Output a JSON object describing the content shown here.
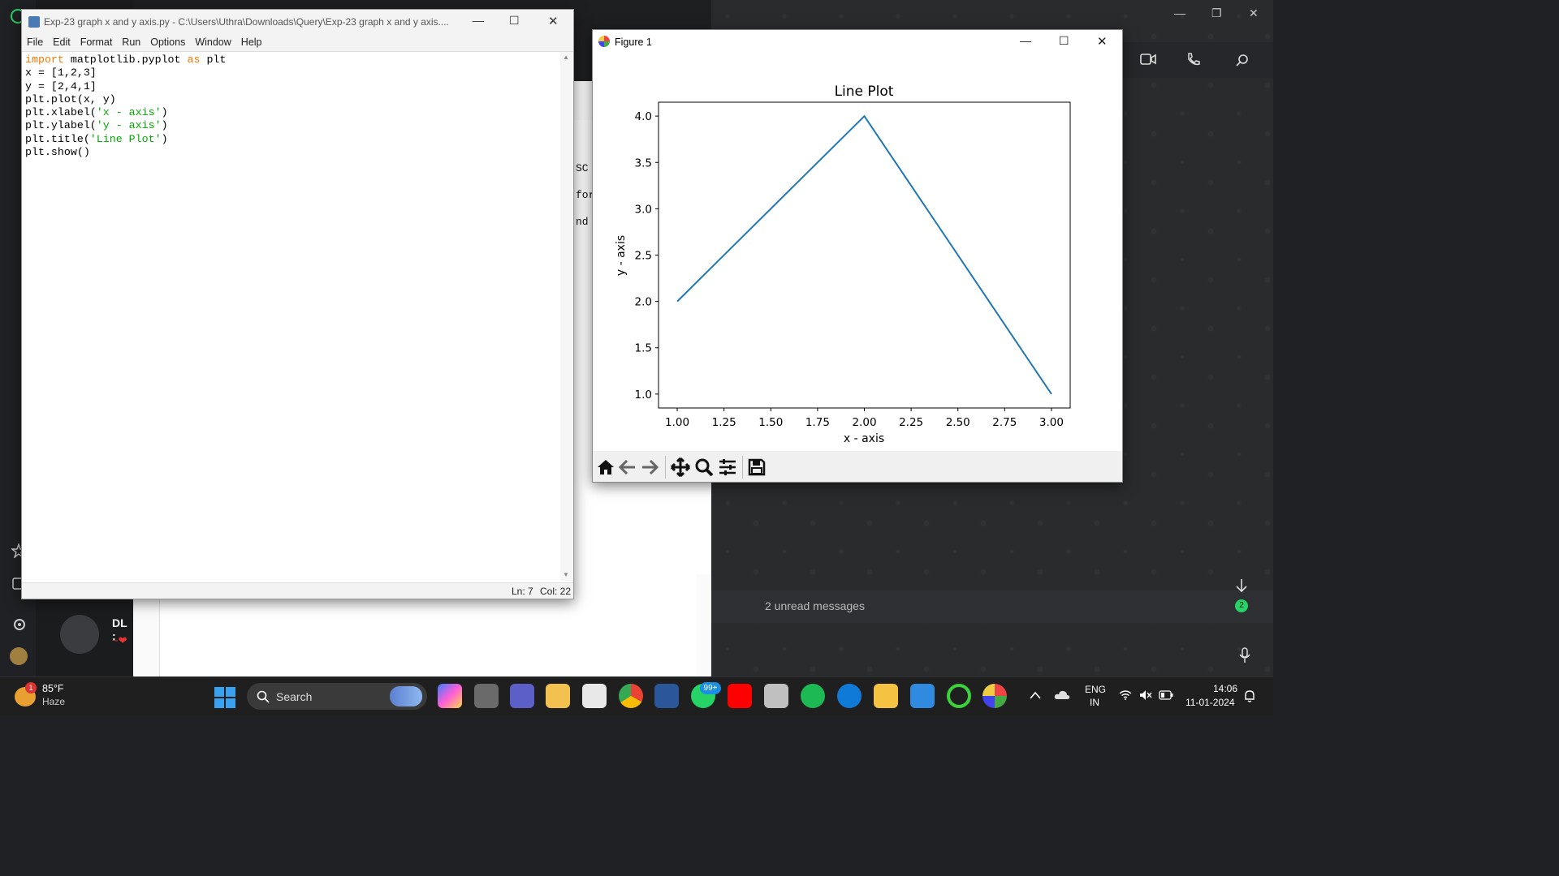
{
  "whatsapp": {
    "chat_preview_name": "DL :",
    "chat_preview_snippet": "~❤",
    "unread_banner": "2 unread messages",
    "unread_badge": "2"
  },
  "idle_peek_text": [
    "SC",
    "for",
    "nd"
  ],
  "editor": {
    "title": "Exp-23 graph x and y axis.py - C:\\Users\\Uthra\\Downloads\\Query\\Exp-23 graph x and y axis....",
    "menu": [
      "File",
      "Edit",
      "Format",
      "Run",
      "Options",
      "Window",
      "Help"
    ],
    "code_lines": [
      [
        {
          "t": "import",
          "c": "kw"
        },
        {
          "t": " matplotlib.pyplot ",
          "c": ""
        },
        {
          "t": "as",
          "c": "kw"
        },
        {
          "t": " plt",
          "c": ""
        }
      ],
      [
        {
          "t": "x = [1,2,3]",
          "c": ""
        }
      ],
      [
        {
          "t": "y = [2,4,1]",
          "c": ""
        }
      ],
      [
        {
          "t": "plt.plot(x, y)",
          "c": ""
        }
      ],
      [
        {
          "t": "plt.xlabel(",
          "c": ""
        },
        {
          "t": "'x - axis'",
          "c": "st"
        },
        {
          "t": ")",
          "c": ""
        }
      ],
      [
        {
          "t": "plt.ylabel(",
          "c": ""
        },
        {
          "t": "'y - axis'",
          "c": "st"
        },
        {
          "t": ")",
          "c": ""
        }
      ],
      [
        {
          "t": "plt.title(",
          "c": ""
        },
        {
          "t": "'Line Plot'",
          "c": "st"
        },
        {
          "t": ")",
          "c": ""
        }
      ],
      [
        {
          "t": "plt.show()",
          "c": ""
        }
      ]
    ],
    "status_ln": "Ln: 7",
    "status_col": "Col: 22"
  },
  "figure": {
    "title": "Figure 1"
  },
  "chart_data": {
    "type": "line",
    "title": "Line Plot",
    "xlabel": "x - axis",
    "ylabel": "y - axis",
    "x": [
      1,
      2,
      3
    ],
    "series": [
      {
        "values": [
          2,
          4,
          1
        ],
        "color": "#1f77b4"
      }
    ],
    "xlim": [
      0.9,
      3.1
    ],
    "ylim": [
      0.85,
      4.15
    ],
    "xticks": [
      "1.00",
      "1.25",
      "1.50",
      "1.75",
      "2.00",
      "2.25",
      "2.50",
      "2.75",
      "3.00"
    ],
    "xtick_values": [
      1.0,
      1.25,
      1.5,
      1.75,
      2.0,
      2.25,
      2.5,
      2.75,
      3.0
    ],
    "yticks": [
      "1.0",
      "1.5",
      "2.0",
      "2.5",
      "3.0",
      "3.5",
      "4.0"
    ],
    "ytick_values": [
      1.0,
      1.5,
      2.0,
      2.5,
      3.0,
      3.5,
      4.0
    ],
    "grid": false,
    "legend": "none"
  },
  "taskbar": {
    "weather_temp": "85°F",
    "weather_desc": "Haze",
    "weather_badge": "1",
    "search_label": "Search",
    "whatsapp_badge": "99+",
    "lang_line1": "ENG",
    "lang_line2": "IN",
    "time": "14:06",
    "date": "11-01-2024"
  }
}
